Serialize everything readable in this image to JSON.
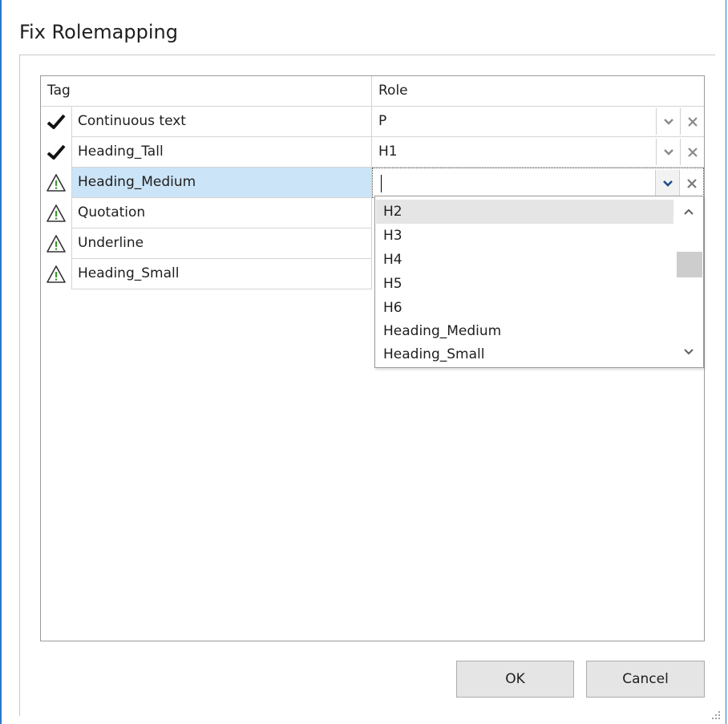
{
  "dialog": {
    "title": "Fix Rolemapping"
  },
  "grid": {
    "headers": {
      "tag": "Tag",
      "role": "Role"
    },
    "rows": [
      {
        "status": "check-icon",
        "tag": "Continuous text",
        "role": "P"
      },
      {
        "status": "check-icon",
        "tag": "Heading_Tall",
        "role": "H1"
      },
      {
        "status": "warning-icon",
        "tag": "Heading_Medium",
        "role": ""
      },
      {
        "status": "warning-icon",
        "tag": "Quotation",
        "role": ""
      },
      {
        "status": "warning-icon",
        "tag": "Underline",
        "role": ""
      },
      {
        "status": "warning-icon",
        "tag": "Heading_Small",
        "role": ""
      }
    ],
    "selected_row": 2
  },
  "dropdown": {
    "options": [
      "H2",
      "H3",
      "H4",
      "H5",
      "H6",
      "Heading_Medium",
      "Heading_Small"
    ],
    "highlighted": "H2"
  },
  "buttons": {
    "ok": "OK",
    "cancel": "Cancel"
  },
  "colors": {
    "selection": "#cce4f7",
    "window_border": "#2b79c9",
    "warning_green": "#3a9a2a"
  }
}
